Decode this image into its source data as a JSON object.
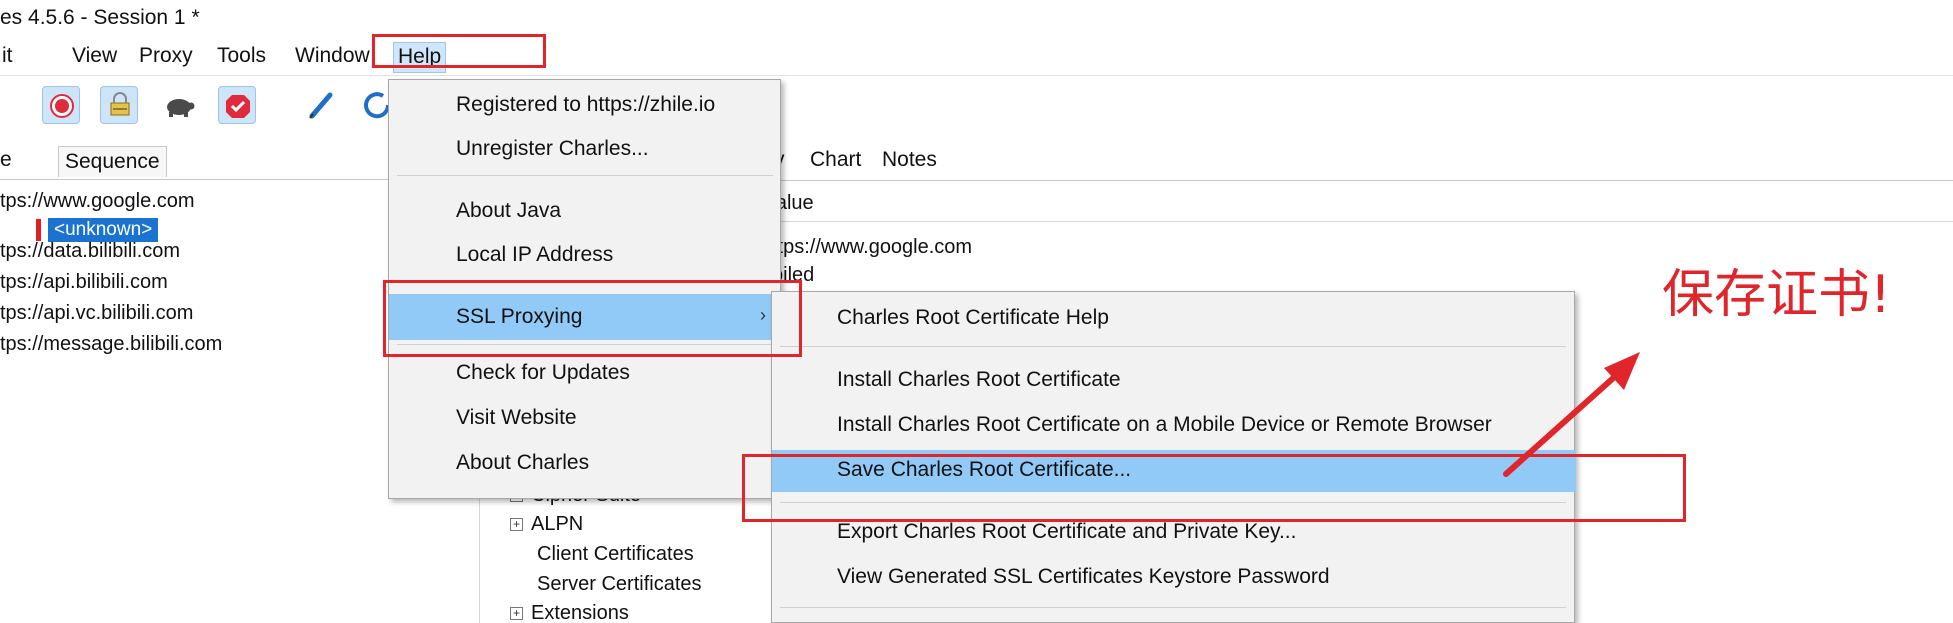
{
  "window": {
    "title": "es 4.5.6 - Session 1 *"
  },
  "menubar": {
    "items": [
      "it",
      "View",
      "Proxy",
      "Tools",
      "Window",
      "Help"
    ]
  },
  "left_pane": {
    "tabs": [
      "e",
      "Sequence"
    ],
    "rows": [
      "tps://www.google.com",
      "<unknown>",
      "tps://data.bilibili.com",
      "tps://api.bilibili.com",
      "tps://api.vc.bilibili.com",
      "tps://message.bilibili.com"
    ]
  },
  "right_pane": {
    "tabs": [
      "y",
      "Chart",
      "Notes"
    ],
    "column_header": "'alue",
    "rows": [
      "ttps://www.google.com",
      "piled"
    ],
    "tree": [
      "Cipher Suite",
      "ALPN",
      "Client Certificates",
      "Server Certificates",
      "Extensions"
    ]
  },
  "help_menu": {
    "items": [
      {
        "label": "Registered to https://zhile.io"
      },
      {
        "label": "Unregister Charles..."
      },
      {
        "label": "About Java"
      },
      {
        "label": "Local IP Address"
      },
      {
        "label": "SSL Proxying",
        "submenu_arrow": "›"
      },
      {
        "label": "Check for Updates"
      },
      {
        "label": "Visit Website"
      },
      {
        "label": "About Charles"
      }
    ]
  },
  "ssl_submenu": {
    "items": [
      {
        "label": "Charles Root Certificate Help"
      },
      {
        "label": "Install Charles Root Certificate"
      },
      {
        "label": "Install Charles Root Certificate on a Mobile Device or Remote Browser"
      },
      {
        "label": "Save Charles Root Certificate..."
      },
      {
        "label": "Export Charles Root Certificate and Private Key..."
      },
      {
        "label": "View Generated SSL Certificates Keystore Password"
      }
    ]
  },
  "annotation": {
    "text": "保存证书!",
    "color": "#e0252b"
  },
  "colors": {
    "highlight": "#91c9f7",
    "selection": "#1b73d1",
    "annotation_red": "#e0252b"
  },
  "icons": [
    "record-icon",
    "throttle-lock-icon",
    "turtle-icon",
    "breakpoint-stop-icon",
    "edit-pen-icon",
    "refresh-icon"
  ]
}
